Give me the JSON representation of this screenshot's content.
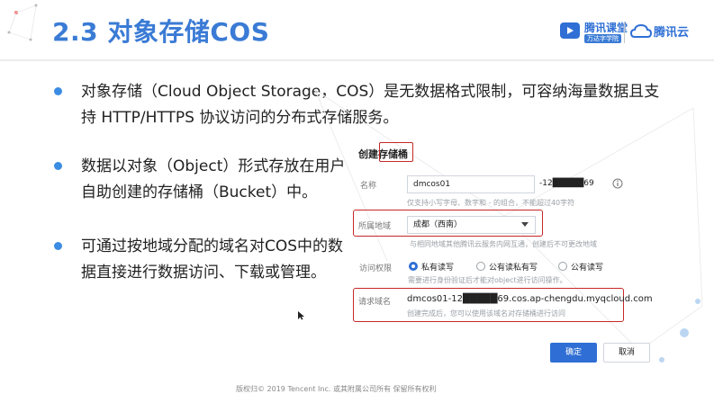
{
  "slide": {
    "title": "2.3 对象存储COS",
    "bullets": [
      {
        "lines": [
          "对象存储（Cloud Object Storage，COS）是无数据格式限制，可容纳海量数据且支",
          "持 HTTP/HTTPS 协议访问的分布式存储服务。"
        ]
      },
      {
        "lines": [
          "数据以对象（Object）形式存放在用户",
          "自助创建的存储桶（Bucket）中。"
        ]
      },
      {
        "lines": [
          "可通过按地域分配的域名对COS中的数",
          "据直接进行数据访问、下载或管理。"
        ]
      }
    ],
    "footer": "版权归© 2019 Tencent Inc. 或其附属公司所有 保留所有权利"
  },
  "logos": {
    "ketang_name": "腾讯课堂",
    "ketang_sub": "万达字学院",
    "cloud_name": "腾讯云"
  },
  "dialog": {
    "title_prefix": "创建",
    "title_highlight": "存储桶",
    "name_label": "名称",
    "name_value": "dmcos01",
    "appid_value": "-12█████69",
    "name_hint": "仅支持小写字母、数字和 - 的组合，不能超过40字符",
    "region_label": "所属地域",
    "region_value": "成都（西南）",
    "region_hint": "与相同地域其他腾讯云服务内网互通，创建后不可更改地域",
    "access_label": "访问权限",
    "access_options": [
      "私有读写",
      "公有读私有写",
      "公有读写"
    ],
    "access_selected": 0,
    "access_hint": "需要进行身份验证后才能对object进行访问操作。",
    "domain_label": "请求域名",
    "domain_value": "dmcos01-12█████69.cos.ap-chengdu.myqcloud.com",
    "domain_hint": "创建完成后，您可以使用该域名对存储桶进行访问",
    "ok_label": "确定",
    "cancel_label": "取消"
  },
  "colors": {
    "title": "#3a7bd5",
    "bullet": "#3b8ce3",
    "highlight_box": "#c62828",
    "primary_button": "#2f6fd5"
  }
}
